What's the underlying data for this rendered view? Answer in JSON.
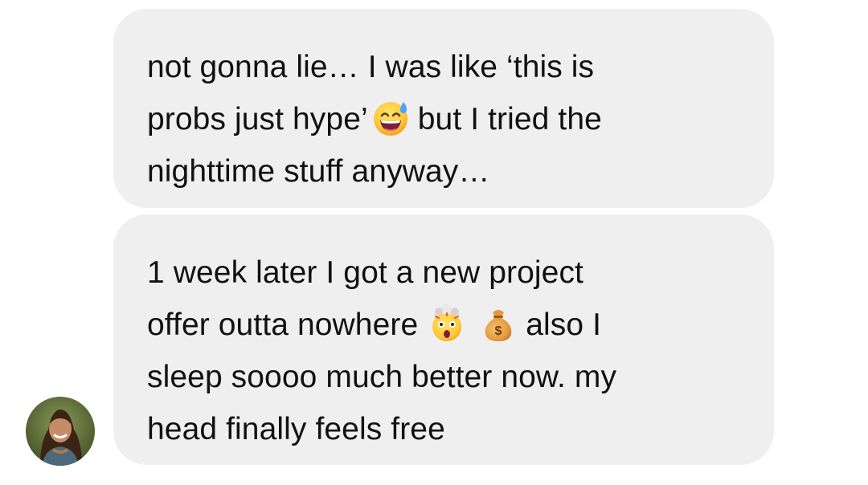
{
  "messages": [
    {
      "lines": [
        {
          "before": "not gonna lie… I was like ‘this is"
        },
        {
          "before": "probs just hype’",
          "emoji": "grinning-sweat-icon",
          "after": "but I tried the"
        },
        {
          "before": "nighttime stuff anyway…"
        }
      ]
    },
    {
      "lines": [
        {
          "before": "1 week later I got a new project"
        },
        {
          "before": "offer outta nowhere",
          "emoji": "exploding-head-icon",
          "emoji2": "money-bag-icon",
          "after": "also I"
        },
        {
          "before": "sleep soooo much better now. my"
        },
        {
          "before": "head finally feels free"
        }
      ]
    }
  ],
  "avatar": {
    "icon": "user-avatar-photo"
  },
  "colors": {
    "bubble_background": "#efefef",
    "text": "#111111",
    "page_background": "#ffffff"
  }
}
